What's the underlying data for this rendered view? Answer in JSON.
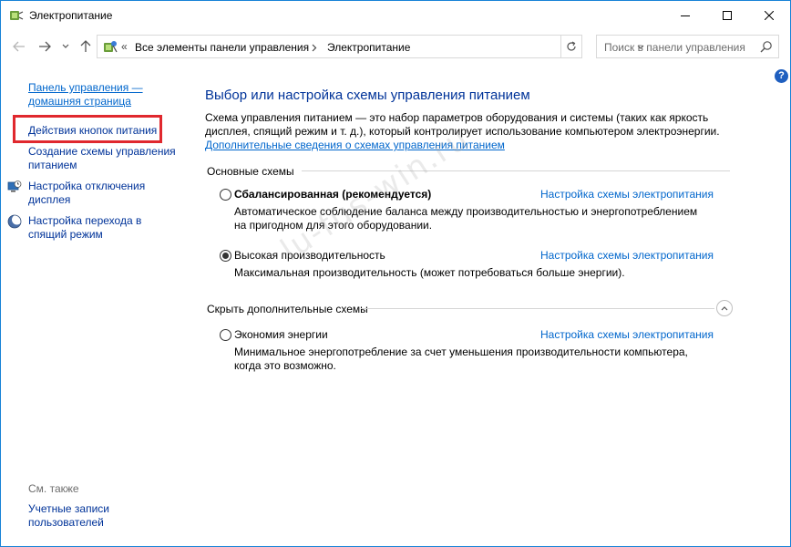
{
  "window": {
    "title": "Электропитание"
  },
  "address": {
    "overflow": "«",
    "crumbs": [
      "Все элементы панели управления",
      "Электропитание"
    ]
  },
  "search": {
    "placeholder": "Поиск в панели управления"
  },
  "help_label": "?",
  "sidebar": {
    "home_link": "Панель управления — домашняя страница",
    "items": [
      {
        "label": "Действия кнопок питания",
        "icon": "none"
      },
      {
        "label": "Создание схемы управления питанием",
        "icon": "none"
      },
      {
        "label": "Настройка отключения дисплея",
        "icon": "monitor-clock-icon"
      },
      {
        "label": "Настройка перехода в спящий режим",
        "icon": "moon-icon"
      }
    ],
    "see_also": "См. также",
    "user_accounts": "Учетные записи пользователей"
  },
  "main": {
    "title": "Выбор или настройка схемы управления питанием",
    "description": "Схема управления питанием — это набор параметров оборудования и системы (таких как яркость дисплея, спящий режим и т. д.), который контролирует использование компьютером электроэнергии.",
    "more_link": "Дополнительные сведения о схемах управления питанием",
    "basic_group": "Основные схемы",
    "hidden_group": "Скрыть дополнительные схемы",
    "plans": [
      {
        "name": "Сбалансированная (рекомендуется)",
        "description": "Автоматическое соблюдение баланса между производительностью и энергопотреблением на пригодном для этого оборудовании.",
        "link": "Настройка схемы электропитания",
        "selected": false
      },
      {
        "name": "Высокая производительность",
        "description": "Максимальная производительность (может потребоваться больше энергии).",
        "link": "Настройка схемы электропитания",
        "selected": true
      },
      {
        "name": "Экономия энергии",
        "description": "Минимальное энергопотребление за счет уменьшения производительности компьютера, когда это возможно.",
        "link": "Настройка схемы электропитания",
        "selected": false
      }
    ]
  },
  "watermark": "lu-fus-win.ru",
  "colors": {
    "link": "#0066cc",
    "nav_link": "#003399",
    "highlight": "#e0282e",
    "window_border": "#1883d7"
  }
}
